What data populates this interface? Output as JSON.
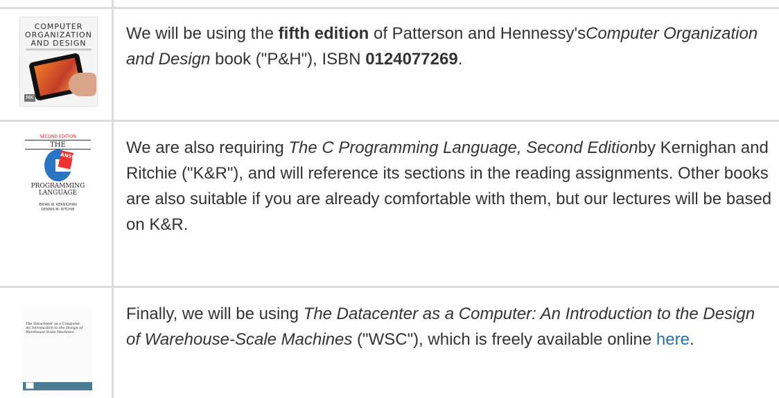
{
  "rows": [
    {
      "description_parts": [
        {
          "text": "We will be using the "
        },
        {
          "text": "fifth edition",
          "style": "bold"
        },
        {
          "text": " of Patterson and Hennessy's"
        },
        {
          "text": "Computer Organization and Design",
          "style": "italic"
        },
        {
          "text": " book (\"P&H\"), ISBN "
        },
        {
          "text": "0124077269",
          "style": "bold"
        },
        {
          "text": "."
        }
      ],
      "cover": {
        "title_line1": "COMPUTER",
        "title_line2": "ORGANIZATION",
        "title_line3": "AND DESIGN",
        "publisher_mark": "MK"
      }
    },
    {
      "description_parts": [
        {
          "text": "We are also requiring "
        },
        {
          "text": "The C Programming Language, Second Edition",
          "style": "italic"
        },
        {
          "text": "by Kernighan and Ritchie (\"K&R\"), and will reference its sections in the reading assignments. Other books are also suitable if you are already comfortable with them, but our lectures will be based on K&R."
        }
      ],
      "cover": {
        "edition": "SECOND EDITION",
        "the": "THE",
        "badge": "ANSI",
        "prog1": "PROGRAMMING",
        "prog2": "LANGUAGE",
        "author1": "BRIAN W. KERNIGHAN",
        "author2": "DENNIS M. RITCHIE"
      }
    },
    {
      "description_parts": [
        {
          "text": "Finally, we will be using "
        },
        {
          "text": "The Datacenter as a Computer: An Introduction to the Design of Warehouse-Scale Machines",
          "style": "italic"
        },
        {
          "text": " (\"WSC\"), which is freely available online "
        },
        {
          "text": "here",
          "style": "link"
        },
        {
          "text": "."
        }
      ],
      "cover": {
        "title": "The Datacenter as a Computer",
        "subtitle": "An Introduction to the Design of Warehouse-Scale Machines"
      }
    }
  ]
}
